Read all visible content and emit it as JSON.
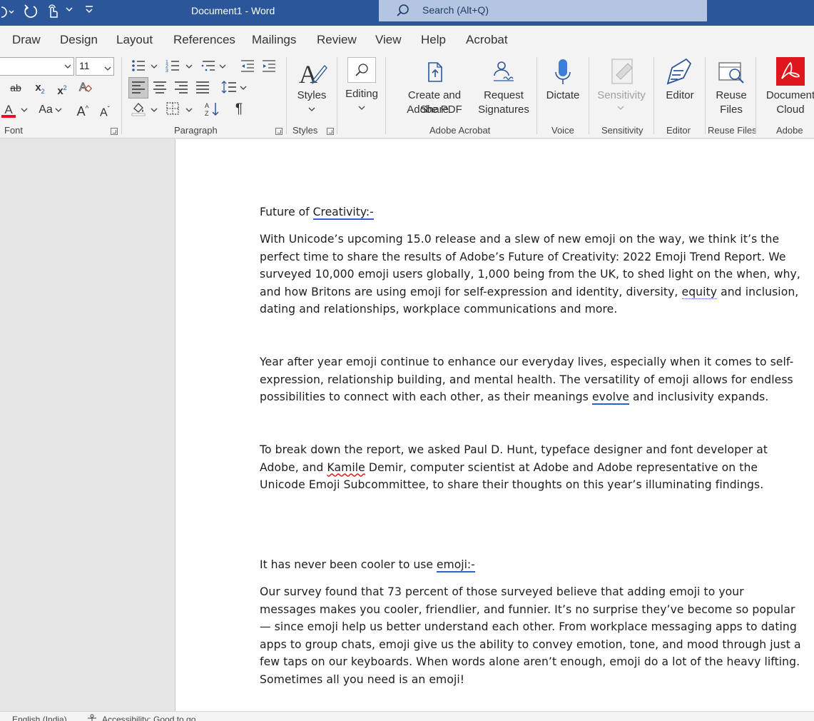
{
  "titlebar": {
    "document_title": "Document1 - Word",
    "search_label": "Search (Alt+Q)"
  },
  "menu": [
    "Draw",
    "Design",
    "Layout",
    "References",
    "Mailings",
    "Review",
    "View",
    "Help",
    "Acrobat"
  ],
  "ribbon": {
    "font_size": "11",
    "groups": {
      "font": "Font",
      "paragraph": "Paragraph",
      "styles": "Styles",
      "adobe_acrobat": "Adobe Acrobat",
      "voice": "Voice",
      "sensitivity": "Sensitivity",
      "editor": "Editor",
      "reuse_files": "Reuse Files",
      "adobe": "Adobe"
    },
    "buttons": {
      "styles": "Styles",
      "editing": "Editing",
      "create_share_1": "Create and Share",
      "create_share_2": "Adobe PDF",
      "request_1": "Request",
      "request_2": "Signatures",
      "dictate": "Dictate",
      "sensitivity": "Sensitivity",
      "editor": "Editor",
      "reuse_1": "Reuse",
      "reuse_2": "Files",
      "doc_cloud_1": "Document",
      "doc_cloud_2": "Cloud"
    },
    "glyphs": {
      "strike": "ab",
      "sub": "x",
      "sub_small": "2",
      "sup": "x",
      "sup_small": "2",
      "font_color": "A",
      "change_case": "Aa",
      "grow": "A",
      "shrink": "A",
      "pilcrow": "¶"
    }
  },
  "document": {
    "heading1_prefix": "Future of ",
    "heading1_link": "Creativity:-",
    "p1_a": "With Unicode’s upcoming 15.0 release and a slew of new emoji on the way, we think it’s the perfect time to share the results of Adobe’s Future of Creativity: 2022 Emoji Trend Report. We surveyed 10,000 emoji users globally, 1,000 being from the UK, to shed light on the when, why, and how Britons are using emoji for self-expression and identity, diversity, ",
    "p1_mark": "equity",
    "p1_b": " and inclusion, dating and relationships, workplace communications and more.",
    "p2_a": "Year after year emoji continue to enhance our everyday lives, especially when it comes to self-expression, relationship building, and mental health. The versatility of emoji allows for endless possibilities to connect with each other, as their meanings ",
    "p2_mark": "evolve",
    "p2_b": " and inclusivity expands.",
    "p3_a": "To break down the report, we asked Paul D. Hunt, typeface designer and font developer at Adobe, and ",
    "p3_mark": "Kamile",
    "p3_b": " Demir, computer scientist at Adobe and Adobe representative on the Unicode Emoji Subcommittee, to share their thoughts on this year’s illuminating findings.",
    "heading2_prefix": "It has never been cooler to use ",
    "heading2_link": "emoji:-",
    "p4": "Our survey found that 73 percent of those surveyed believe that adding emoji to your messages makes you cooler, friendlier, and funnier. It’s no surprise they’ve become so popular — since emoji help us better understand each other. From workplace messaging apps to dating apps to group chats, emoji give us the ability to convey emotion, tone, and mood through just a few taps on our keyboards. When words alone aren’t enough, emoji do a lot of the heavy lifting. Sometimes all you need is an emoji!"
  },
  "status": {
    "language": "English (India)",
    "accessibility": "Accessibility: Good to go"
  },
  "colors": {
    "titlebar": "#2b579a",
    "search_box": "#b4c5e2",
    "adobe_red": "#e0161e",
    "font_color_bar": "#e81123",
    "grammar_underline": "#2f5ecf"
  }
}
